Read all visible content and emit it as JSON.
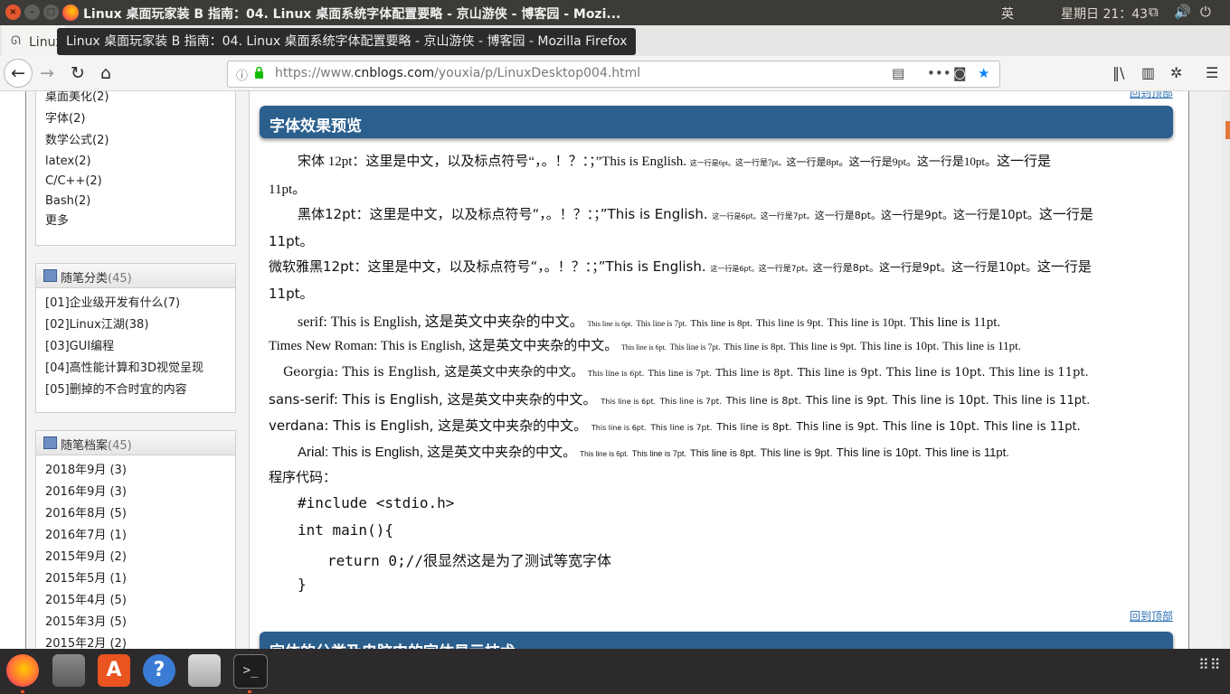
{
  "os_panel": {
    "window_title": "Linux 桌面玩家装 B 指南：04. Linux 桌面系统字体配置要略 - 京山游侠 - 博客园 - Mozi...",
    "input_method": "英",
    "clock": "星期日 21：43"
  },
  "browser": {
    "tab_label": "Linux 桌面玩家装 B 指南：",
    "tooltip": "Linux 桌面玩家装 B 指南：04. Linux 桌面系统字体配置要略 - 京山游侠 - 博客园 - Mozilla Firefox",
    "url_prefix": "https://www.",
    "url_domain": "cnblogs.com",
    "url_path": "/youxia/p/LinuxDesktop004.html",
    "more_dots": "•••"
  },
  "sidebar": {
    "tag_items": [
      "桌面美化(2)",
      "字体(2)",
      "数学公式(2)",
      "latex(2)",
      "C/C++(2)",
      "Bash(2)",
      "更多"
    ],
    "categories": {
      "title": "随笔分类",
      "count": "(45)",
      "items": [
        "[01]企业级开发有什么(7)",
        "[02]Linux江湖(38)",
        "[03]GUI编程",
        "[04]高性能计算和3D视觉呈现",
        "[05]删掉的不合时宜的内容"
      ]
    },
    "archives": {
      "title": "随笔档案",
      "count": "(45)",
      "items": [
        "2018年9月 (3)",
        "2016年9月 (3)",
        "2016年8月 (5)",
        "2016年7月 (1)",
        "2015年9月 (2)",
        "2015年5月 (1)",
        "2015年4月 (5)",
        "2015年3月 (5)",
        "2015年2月 (2)"
      ]
    }
  },
  "article": {
    "section_title": "字体效果预览",
    "next_section_title": "字体的分类及电脑中的字体显示技术",
    "back_to_top": "回到顶部",
    "song": {
      "head": "宋体 12pt：这里是中文，以及标点符号“，。！？：；”This is English.",
      "p6": "这一行是6pt。",
      "p7": "这一行是7pt。",
      "p8": "这一行是8pt。",
      "p9": "这一行是9pt。",
      "p10": "这一行是10pt。",
      "p11a": "这一行是",
      "p11b": "11pt。"
    },
    "hei": {
      "head": "黑体12pt：这里是中文，以及标点符号“，。！？：；”This is English.",
      "p6": "这一行是6pt。",
      "p7": "这一行是7pt。",
      "p8": "这一行是8pt。",
      "p9": "这一行是9pt。",
      "p10": "这一行是10pt。",
      "p11a": "这一行是",
      "p11b": "11pt。"
    },
    "yahei": {
      "head": "微软雅黑12pt：这里是中文，以及标点符号“，。！？：；”This is English.",
      "p6": "这一行是6pt。",
      "p7": "这一行是7pt。",
      "p8": "这一行是8pt。",
      "p9": "这一行是9pt。",
      "p10": "这一行是10pt。",
      "p11a": "这一行是",
      "p11b": "11pt。"
    },
    "latin_lines": [
      {
        "head": "serif: This is English, 这是英文中夹杂的中文。"
      },
      {
        "head": "Times New Roman: This is English, 这是英文中夹杂的中文。"
      },
      {
        "head": "Georgia: This is English, 这是英文中夹杂的中文。"
      },
      {
        "head": "sans-serif: This is English, 这是英文中夹杂的中文。"
      },
      {
        "head": "verdana: This is English, 这是英文中夹杂的中文。"
      },
      {
        "head": "Arial: This is English, 这是英文中夹杂的中文。"
      }
    ],
    "size_tail": {
      "s6": "This line is 6pt.",
      "s7": "This line is 7pt.",
      "s8": "This line is 8pt.",
      "s9": "This line is 9pt.",
      "s10": "This line is 10pt.",
      "s11": "This line is 11pt."
    },
    "code_label": "程序代码：",
    "code": [
      "#include <stdio.h>",
      "int main(){",
      "return 0;//很显然这是为了测试等宽字体",
      "}"
    ]
  },
  "colors": {
    "heading_bar": "#2b5f8d",
    "link": "#2a6fb3",
    "firefox_orange": "#e95420"
  }
}
